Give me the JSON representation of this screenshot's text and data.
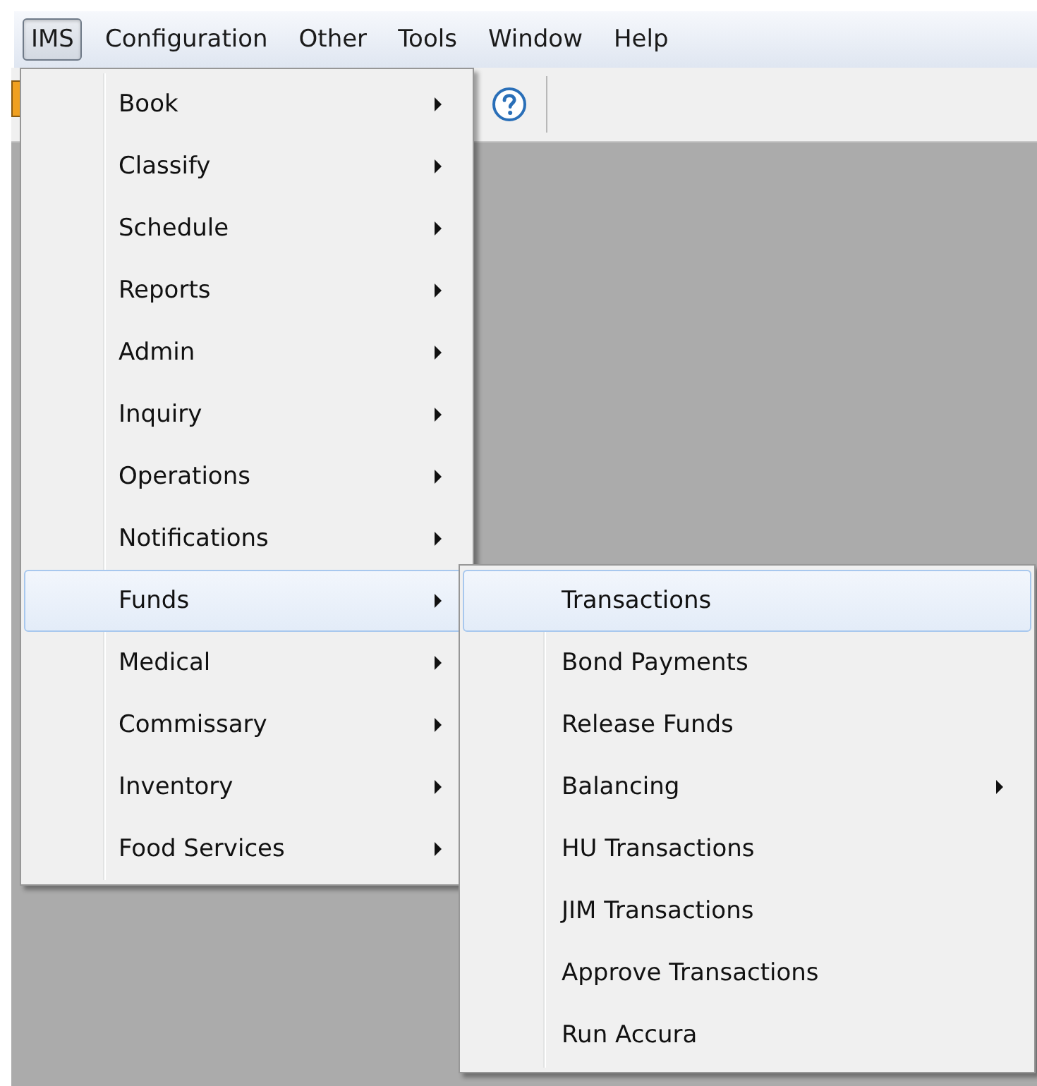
{
  "menubar": [
    {
      "label": "IMS",
      "selected": true
    },
    {
      "label": "Configuration",
      "selected": false
    },
    {
      "label": "Other",
      "selected": false
    },
    {
      "label": "Tools",
      "selected": false
    },
    {
      "label": "Window",
      "selected": false
    },
    {
      "label": "Help",
      "selected": false
    }
  ],
  "menu": {
    "items": [
      {
        "label": "Book",
        "selected": false,
        "has_submenu": true
      },
      {
        "label": "Classify",
        "selected": false,
        "has_submenu": true
      },
      {
        "label": "Schedule",
        "selected": false,
        "has_submenu": true
      },
      {
        "label": "Reports",
        "selected": false,
        "has_submenu": true
      },
      {
        "label": "Admin",
        "selected": false,
        "has_submenu": true
      },
      {
        "label": "Inquiry",
        "selected": false,
        "has_submenu": true
      },
      {
        "label": "Operations",
        "selected": false,
        "has_submenu": true
      },
      {
        "label": "Notifications",
        "selected": false,
        "has_submenu": true
      },
      {
        "label": "Funds",
        "selected": true,
        "has_submenu": true
      },
      {
        "label": "Medical",
        "selected": false,
        "has_submenu": true
      },
      {
        "label": "Commissary",
        "selected": false,
        "has_submenu": true
      },
      {
        "label": "Inventory",
        "selected": false,
        "has_submenu": true
      },
      {
        "label": "Food Services",
        "selected": false,
        "has_submenu": true
      }
    ]
  },
  "submenu": {
    "items": [
      {
        "label": "Transactions",
        "selected": true,
        "has_submenu": false
      },
      {
        "label": "Bond Payments",
        "selected": false,
        "has_submenu": false
      },
      {
        "label": "Release Funds",
        "selected": false,
        "has_submenu": false
      },
      {
        "label": "Balancing",
        "selected": false,
        "has_submenu": true
      },
      {
        "label": "HU Transactions",
        "selected": false,
        "has_submenu": false
      },
      {
        "label": "JIM Transactions",
        "selected": false,
        "has_submenu": false
      },
      {
        "label": "Approve Transactions",
        "selected": false,
        "has_submenu": false
      },
      {
        "label": "Run Accura",
        "selected": false,
        "has_submenu": false
      }
    ]
  }
}
